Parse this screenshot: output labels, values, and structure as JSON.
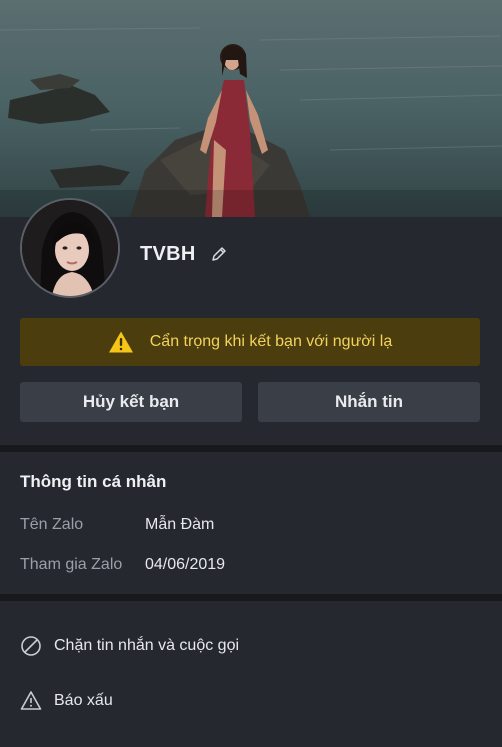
{
  "profile": {
    "display_name": "TVBH"
  },
  "warning": {
    "text": "Cẩn trọng khi kết bạn với người lạ"
  },
  "buttons": {
    "unfriend": "Hủy kết bạn",
    "message": "Nhắn tin"
  },
  "personal_info": {
    "title": "Thông tin cá nhân",
    "rows": [
      {
        "label": "Tên Zalo",
        "value": "Mẫn Đàm"
      },
      {
        "label": "Tham gia Zalo",
        "value": "04/06/2019"
      }
    ]
  },
  "actions": [
    {
      "label": "Chặn tin nhắn và cuộc gọi",
      "icon": "block-icon"
    },
    {
      "label": "Báo xấu",
      "icon": "warning-triangle-icon"
    }
  ],
  "colors": {
    "background": "#25282f",
    "warning_bg": "#4b3d0d",
    "warning_text": "#f3d35c",
    "button_bg": "#3a3e47"
  }
}
